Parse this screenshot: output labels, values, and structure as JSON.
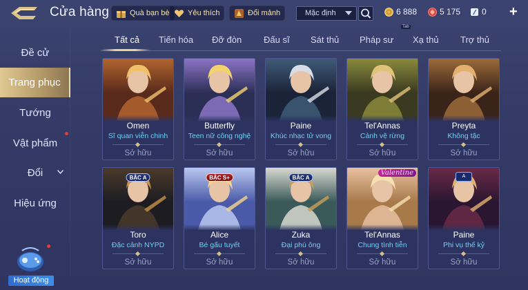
{
  "topbar": {
    "title": "Cửa hàng",
    "buttons": [
      {
        "label": "Quà bạn bè",
        "icon": "gift-icon"
      },
      {
        "label": "Yêu thích",
        "icon": "heart-icon"
      },
      {
        "label": "Đổi mảnh",
        "icon": "fragment-icon"
      }
    ],
    "sort": {
      "selected": "Mặc định"
    },
    "currencies": [
      {
        "icon": "gold-coin-icon",
        "value": "6 888",
        "color": "#e7b44a"
      },
      {
        "icon": "gem-icon",
        "value": "5 175",
        "color": "#d9473f"
      },
      {
        "icon": "voucher-icon",
        "value": "0",
        "color": "#6fa8ff"
      }
    ],
    "plus_label": "+"
  },
  "sidebar": {
    "items": [
      {
        "label": "Đề cử",
        "icon": ""
      },
      {
        "label": "Trang phục",
        "icon": "",
        "active": true
      },
      {
        "label": "Tướng",
        "icon": ""
      },
      {
        "label": "Vật phẩm",
        "icon": "",
        "notification": true
      },
      {
        "label": "Đổi",
        "icon": "chevron-down-icon"
      },
      {
        "label": "Hiệu ứng",
        "icon": ""
      }
    ],
    "event": {
      "label": "Hoạt động",
      "icon": "gamepad-icon",
      "notification": true
    }
  },
  "tabs": [
    {
      "label": "Tất cả",
      "active": true
    },
    {
      "label": "Tiến hóa"
    },
    {
      "label": "Đỡ đòn"
    },
    {
      "label": "Đấu sĩ"
    },
    {
      "label": "Sát thủ"
    },
    {
      "label": "Pháp sư"
    },
    {
      "label": "Xạ thủ"
    },
    {
      "label": "Trợ thủ"
    }
  ],
  "tab_badge": "Tab",
  "skins": [
    {
      "hero": "Omen",
      "skin": "Sĩ quan viễn chinh",
      "status": "Sở hữu",
      "tier": "",
      "palette": [
        "#5a2a1c",
        "#b0642e",
        "#f0c06a"
      ]
    },
    {
      "hero": "Butterfly",
      "skin": "Teen nữ công nghệ",
      "status": "Sở hữu",
      "tier": "",
      "palette": [
        "#2b2f55",
        "#8c74c6",
        "#f3d26e"
      ]
    },
    {
      "hero": "Paine",
      "skin": "Khúc nhạc tử vong",
      "status": "Sở hữu",
      "tier": "",
      "palette": [
        "#1a2438",
        "#3f5a78",
        "#d8dce6"
      ]
    },
    {
      "hero": "Tel'Annas",
      "skin": "Cảnh vệ rừng",
      "status": "Sở hữu",
      "tier": "",
      "palette": [
        "#3a3a22",
        "#8a8a3c",
        "#e0c27a"
      ]
    },
    {
      "hero": "Preyta",
      "skin": "Không tặc",
      "status": "Sở hữu",
      "tier": "",
      "palette": [
        "#3a2418",
        "#9c6a3a",
        "#e4b070"
      ]
    },
    {
      "hero": "Toro",
      "skin": "Đặc cảnh NYPD",
      "status": "Sở hữu",
      "tier": "BẬC A",
      "palette": [
        "#1c1c22",
        "#4a3a2a",
        "#c89048"
      ]
    },
    {
      "hero": "Alice",
      "skin": "Bé gấu tuyết",
      "status": "Sở hữu",
      "tier": "BẬC S+",
      "palette": [
        "#4a5aa8",
        "#b9c8f0",
        "#f5d48a"
      ]
    },
    {
      "hero": "Zuka",
      "skin": "Đại phú ông",
      "status": "Sở hữu",
      "tier": "BẬC A",
      "palette": [
        "#3a5a5a",
        "#d8d8d0",
        "#caa058"
      ]
    },
    {
      "hero": "Tel'Annas",
      "skin": "Chung tình tiễn",
      "status": "Sở hữu",
      "tier": "Valentine",
      "palette": [
        "#a87a4a",
        "#e8c0a0",
        "#f5e0b0"
      ]
    },
    {
      "hero": "Paine",
      "skin": "Phi vụ thế kỷ",
      "status": "Sở hữu",
      "tier": "A",
      "palette": [
        "#2a1630",
        "#6a2a48",
        "#e0b070"
      ]
    }
  ]
}
